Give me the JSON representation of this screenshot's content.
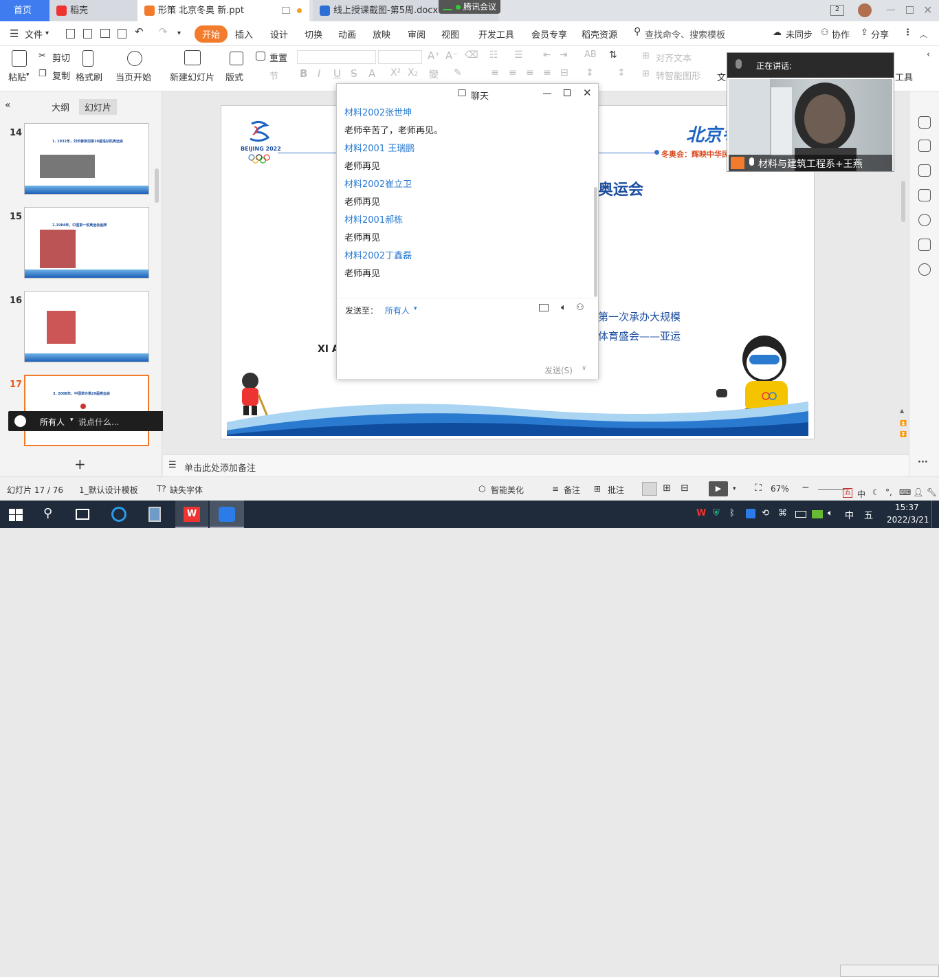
{
  "tabs": {
    "home": "首页",
    "docer": "稻壳",
    "ppt": "形策 北京冬奥 新.ppt",
    "docx": "线上授课截图-第5周.docx",
    "meeting": "腾讯会议"
  },
  "menu": {
    "file": "文件",
    "items": [
      "开始",
      "插入",
      "设计",
      "切换",
      "动画",
      "放映",
      "审阅",
      "视图",
      "开发工具",
      "会员专享",
      "稻壳资源"
    ],
    "search": "查找命令、搜索模板",
    "unsync": "未同步",
    "collab": "协作",
    "share": "分享"
  },
  "ribbon": {
    "paste": "粘贴",
    "cut": "剪切",
    "copy": "复制",
    "format_brush": "格式刷",
    "play_current": "当页开始",
    "new_slide": "新建幻灯片",
    "layout": "版式",
    "reset": "重置",
    "section": "节",
    "align_text": "对齐文本",
    "smart_shape": "转智能图形",
    "text": "文",
    "tools": "工具"
  },
  "left_panel": {
    "outline": "大纲",
    "slides": "幻灯片",
    "thumbnails": [
      {
        "num": "14",
        "title": "1. 1932年，刘长春参加第10届洛杉矶奥运会"
      },
      {
        "num": "15",
        "title": "2.1984年，中国第一枚奥运会金牌"
      },
      {
        "num": "16",
        "title": ""
      },
      {
        "num": "17",
        "title": "3. 2008年，中国举办第29届奥运会"
      }
    ],
    "add": "+"
  },
  "slide": {
    "logo_text": "BEIJING 2022",
    "header_right": "北京冬",
    "tagline": "冬奥会：辉映中华民",
    "title_fragment": "奥运会",
    "body_line1": "第一次承办大规模",
    "body_line2": "体育盛会——亚运",
    "fragment": "XI A"
  },
  "notes": {
    "placeholder": "单击此处添加备注"
  },
  "chat": {
    "title": "聊天",
    "messages": [
      {
        "sender": "材料2002张世坤",
        "text": "老师辛苦了，老师再见。"
      },
      {
        "sender": "材料2001 王瑞鹏",
        "text": "老师再见"
      },
      {
        "sender": "材料2002崔立卫",
        "text": "老师再见"
      },
      {
        "sender": "材料2001郝栋",
        "text": "老师再见"
      },
      {
        "sender": "材料2002丁鑫磊",
        "text": "老师再见"
      }
    ],
    "send_to_label": "发送至：",
    "send_to_value": "所有人",
    "send_button": "发送(S)"
  },
  "video": {
    "speaking_label": "正在讲话:",
    "participant": "材料与建筑工程系+王燕"
  },
  "meeting_bar": {
    "recipient": "所有人",
    "placeholder": "说点什么..."
  },
  "status": {
    "slide_pos": "幻灯片 17 / 76",
    "template": "1_默认设计模板",
    "missing_font": "缺失字体",
    "beautify": "智能美化",
    "notes": "备注",
    "comments": "批注",
    "zoom": "67%"
  },
  "taskbar": {
    "ime": "中",
    "ime2": "五",
    "time": "15:37",
    "date": "2022/3/21"
  },
  "colors": {
    "accent_orange": "#f27b2c",
    "tab_blue": "#3f7cf0",
    "chat_name_blue": "#2a7ad0",
    "slide_blue": "#1d63c4"
  }
}
